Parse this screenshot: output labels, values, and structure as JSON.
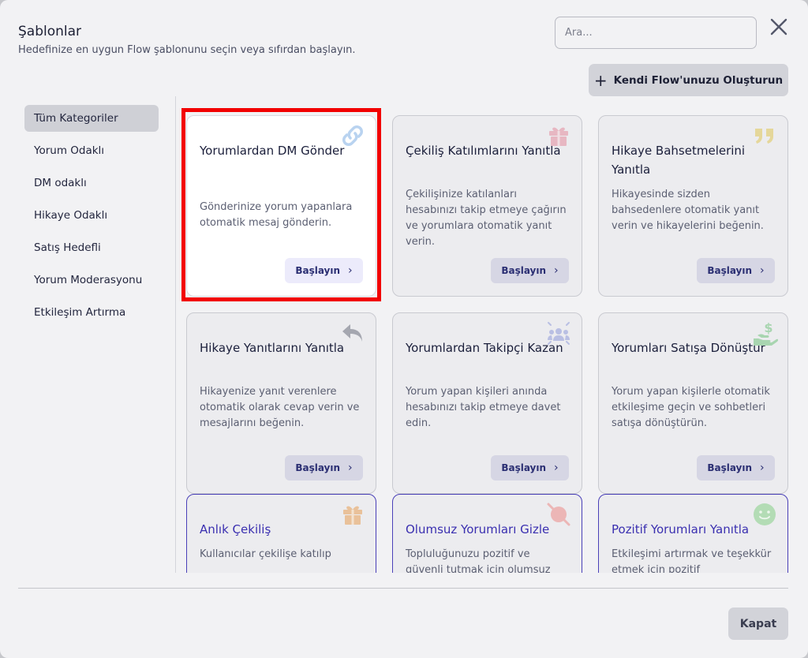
{
  "header": {
    "title": "Şablonlar",
    "subtitle": "Hedefinize en uygun Flow şablonunu seçin veya sıfırdan başlayın.",
    "search_placeholder": "Ara...",
    "close_icon": "close-icon",
    "create_button_label": "Kendi Flow'unuzu Oluşturun"
  },
  "sidebar": {
    "items": [
      {
        "label": "Tüm Kategoriler",
        "active": true
      },
      {
        "label": "Yorum Odaklı"
      },
      {
        "label": "DM odaklı"
      },
      {
        "label": "Hikaye Odaklı"
      },
      {
        "label": "Satış Hedefli"
      },
      {
        "label": "Yorum Moderasyonu"
      },
      {
        "label": "Etkileşim Artırma"
      }
    ]
  },
  "cards": [
    {
      "title": "Yorumlardan DM Gönder",
      "description": "Gönderinize yorum yapanlara otomatik mesaj gönderin.",
      "button": "Başlayın",
      "icon": "link-icon",
      "icon_color": "#b9d3f0"
    },
    {
      "title": "Çekiliş Katılımlarını Yanıtla",
      "description": "Çekilişinize katılanları hesabınızı takip etmeye çağırın ve yorumlara otomatik yanıt verin.",
      "button": "Başlayın",
      "icon": "gift-icon",
      "icon_color": "#e7b7c2"
    },
    {
      "title": "Hikaye Bahsetmelerini Yanıtla",
      "description": "Hikayesinde sizden bahsedenlere otomatik yanıt verin ve hikayelerini beğenin.",
      "button": "Başlayın",
      "icon": "quote-icon",
      "icon_color": "#e5d79a"
    },
    {
      "title": "Hikaye Yanıtlarını Yanıtla",
      "description": "Hikayenize yanıt verenlere otomatik olarak cevap verin ve mesajlarını beğenin.",
      "button": "Başlayın",
      "icon": "reply-icon",
      "icon_color": "#a5a7b0"
    },
    {
      "title": "Yorumlardan Takipçi Kazan",
      "description": "Yorum yapan kişileri anında hesabınızı takip etmeye davet edin.",
      "button": "Başlayın",
      "icon": "users-icon",
      "icon_color": "#b9bfe3"
    },
    {
      "title": "Yorumları Satışa Dönüştür",
      "description": "Yorum yapan kişilerle otomatik etkileşime geçin ve sohbetleri satışa dönüştürün.",
      "button": "Başlayın",
      "icon": "money-hand-icon",
      "icon_color": "#a8d5b0"
    },
    {
      "title": "Anlık Çekiliş",
      "description": "Kullanıcılar çekilişe katılıp",
      "icon": "gift-icon",
      "icon_color": "#e9c19a"
    },
    {
      "title": "Olumsuz Yorumları Gizle",
      "description": "Topluluğunuzu pozitif ve güvenli tutmak için olumsuz",
      "icon": "hide-comment-icon",
      "icon_color": "#ecb6b6"
    },
    {
      "title": "Pozitif Yorumları Yanıtla",
      "description": "Etkileşimi artırmak ve teşekkür etmek için pozitif",
      "icon": "smile-icon",
      "icon_color": "#b3dcb5"
    }
  ],
  "footer": {
    "close_button_label": "Kapat"
  }
}
